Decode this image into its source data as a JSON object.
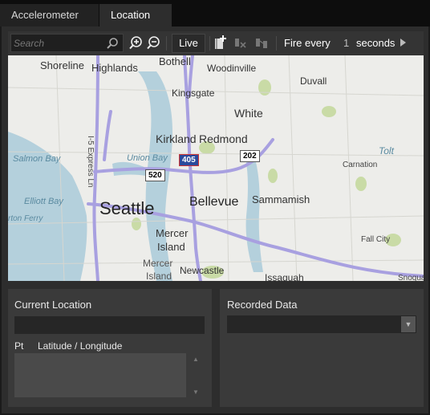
{
  "tabs": [
    {
      "label": "Accelerometer",
      "active": false
    },
    {
      "label": "Location",
      "active": true
    }
  ],
  "toolbar": {
    "search_placeholder": "Search",
    "live_label": "Live",
    "fire_every_label": "Fire every",
    "interval_value": "1",
    "interval_unit": "seconds"
  },
  "map": {
    "labels": {
      "shoreline": "Shoreline",
      "highlands": "Highlands",
      "bothell": "Bothell",
      "woodinville": "Woodinville",
      "duvall": "Duvall",
      "kingsgate": "Kingsgate",
      "white": "White",
      "kirkland": "Kirkland",
      "redmond": "Redmond",
      "tolt": "Tolt",
      "union_bay": "Union Bay",
      "salmon_bay": "Salmon Bay",
      "carnation": "Carnation",
      "i5_express": "I-5 Express Ln",
      "elliott_bay": "Elliott Bay",
      "seattle": "Seattle",
      "bellevue": "Bellevue",
      "sammamish": "Sammamish",
      "ferry": "rton Ferry",
      "mercer_island_1": "Mercer",
      "mercer_island_2": "Island",
      "mercer_island_3": "Mercer",
      "mercer_island_4": "Island",
      "newcastle": "Newcastle",
      "fall_city": "Fall City",
      "issaquah": "Issaquah",
      "snoqualmie": "Snoqualm"
    },
    "shields": {
      "i405": "405",
      "sr520": "520",
      "sr202": "202"
    },
    "colors": {
      "land": "#ededea",
      "water": "#b4d0dc",
      "highway": "#a8a0e0",
      "park": "#c9dba6"
    }
  },
  "current_location": {
    "title": "Current Location",
    "value": "",
    "col_pt": "Pt",
    "col_latlon": "Latitude / Longitude"
  },
  "recorded_data": {
    "title": "Recorded Data",
    "selected": ""
  }
}
